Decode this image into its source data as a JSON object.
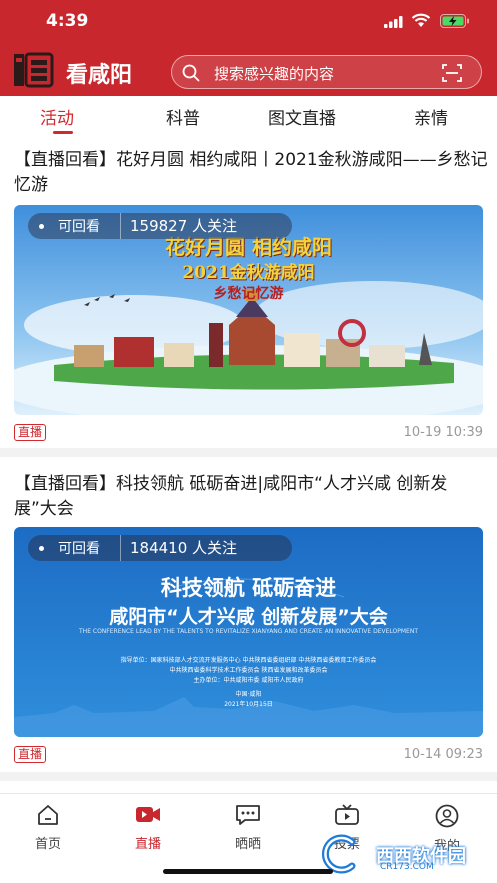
{
  "status_bar": {
    "time": "4:39"
  },
  "header": {
    "app_title": "看咸阳",
    "search_placeholder": "搜索感兴趣的内容",
    "logo_icon": "xianyang-seal-logo"
  },
  "tabs": [
    {
      "label": "活动",
      "active": true
    },
    {
      "label": "科普",
      "active": false
    },
    {
      "label": "图文直播",
      "active": false
    },
    {
      "label": "亲情",
      "active": false
    }
  ],
  "feed": [
    {
      "title": "【直播回看】花好月圆 相约咸阳丨2021金秋游咸阳——乡愁记忆游",
      "replay_label": "可回看",
      "views": "159827 人关注",
      "banner_line1": "花好月圆  相约咸阳",
      "banner_line2": "2021金秋游咸阳",
      "banner_line3": "乡愁记忆游",
      "badge": "直播",
      "date": "10-19 10:39"
    },
    {
      "title": "【直播回看】科技领航 砥砺奋进|咸阳市“人才兴咸 创新发展”大会",
      "replay_label": "可回看",
      "views": "184410 人关注",
      "banner_line1": "科技领航  砥砺奋进",
      "banner_line2": "咸阳市“人才兴咸  创新发展”大会",
      "banner_line3": "THE CONFERENCE LEAD BY THE TALENTS TO REVITALIZE XIANYANG AND CREATE AN INNOVATIVE DEVELOPMENT",
      "org1": "指导单位：国家科技部人才交流开发服务中心   中共陕西省委组织部   中共陕西省委教育工作委员会",
      "org2": "中共陕西省委科学技术工作委员会   陕西省发展和改革委员会",
      "org3": "主办单位：中共咸阳市委   咸阳市人民政府",
      "place": "中国·咸阳",
      "event_date": "2021年10月15日",
      "badge": "直播",
      "date": "10-14 09:23"
    }
  ],
  "bottom_nav": [
    {
      "label": "首页",
      "icon": "home-icon",
      "active": false
    },
    {
      "label": "直播",
      "icon": "video-camera-icon",
      "active": true
    },
    {
      "label": "晒晒",
      "icon": "chat-bubble-icon",
      "active": false
    },
    {
      "label": "投票",
      "icon": "tv-icon",
      "active": false
    },
    {
      "label": "我的",
      "icon": "user-icon",
      "active": false
    }
  ],
  "watermark": {
    "text": "西西软件园",
    "url": "CR173.COM"
  },
  "colors": {
    "brand_red": "#c8272d",
    "accent_red": "#d02a2f"
  }
}
